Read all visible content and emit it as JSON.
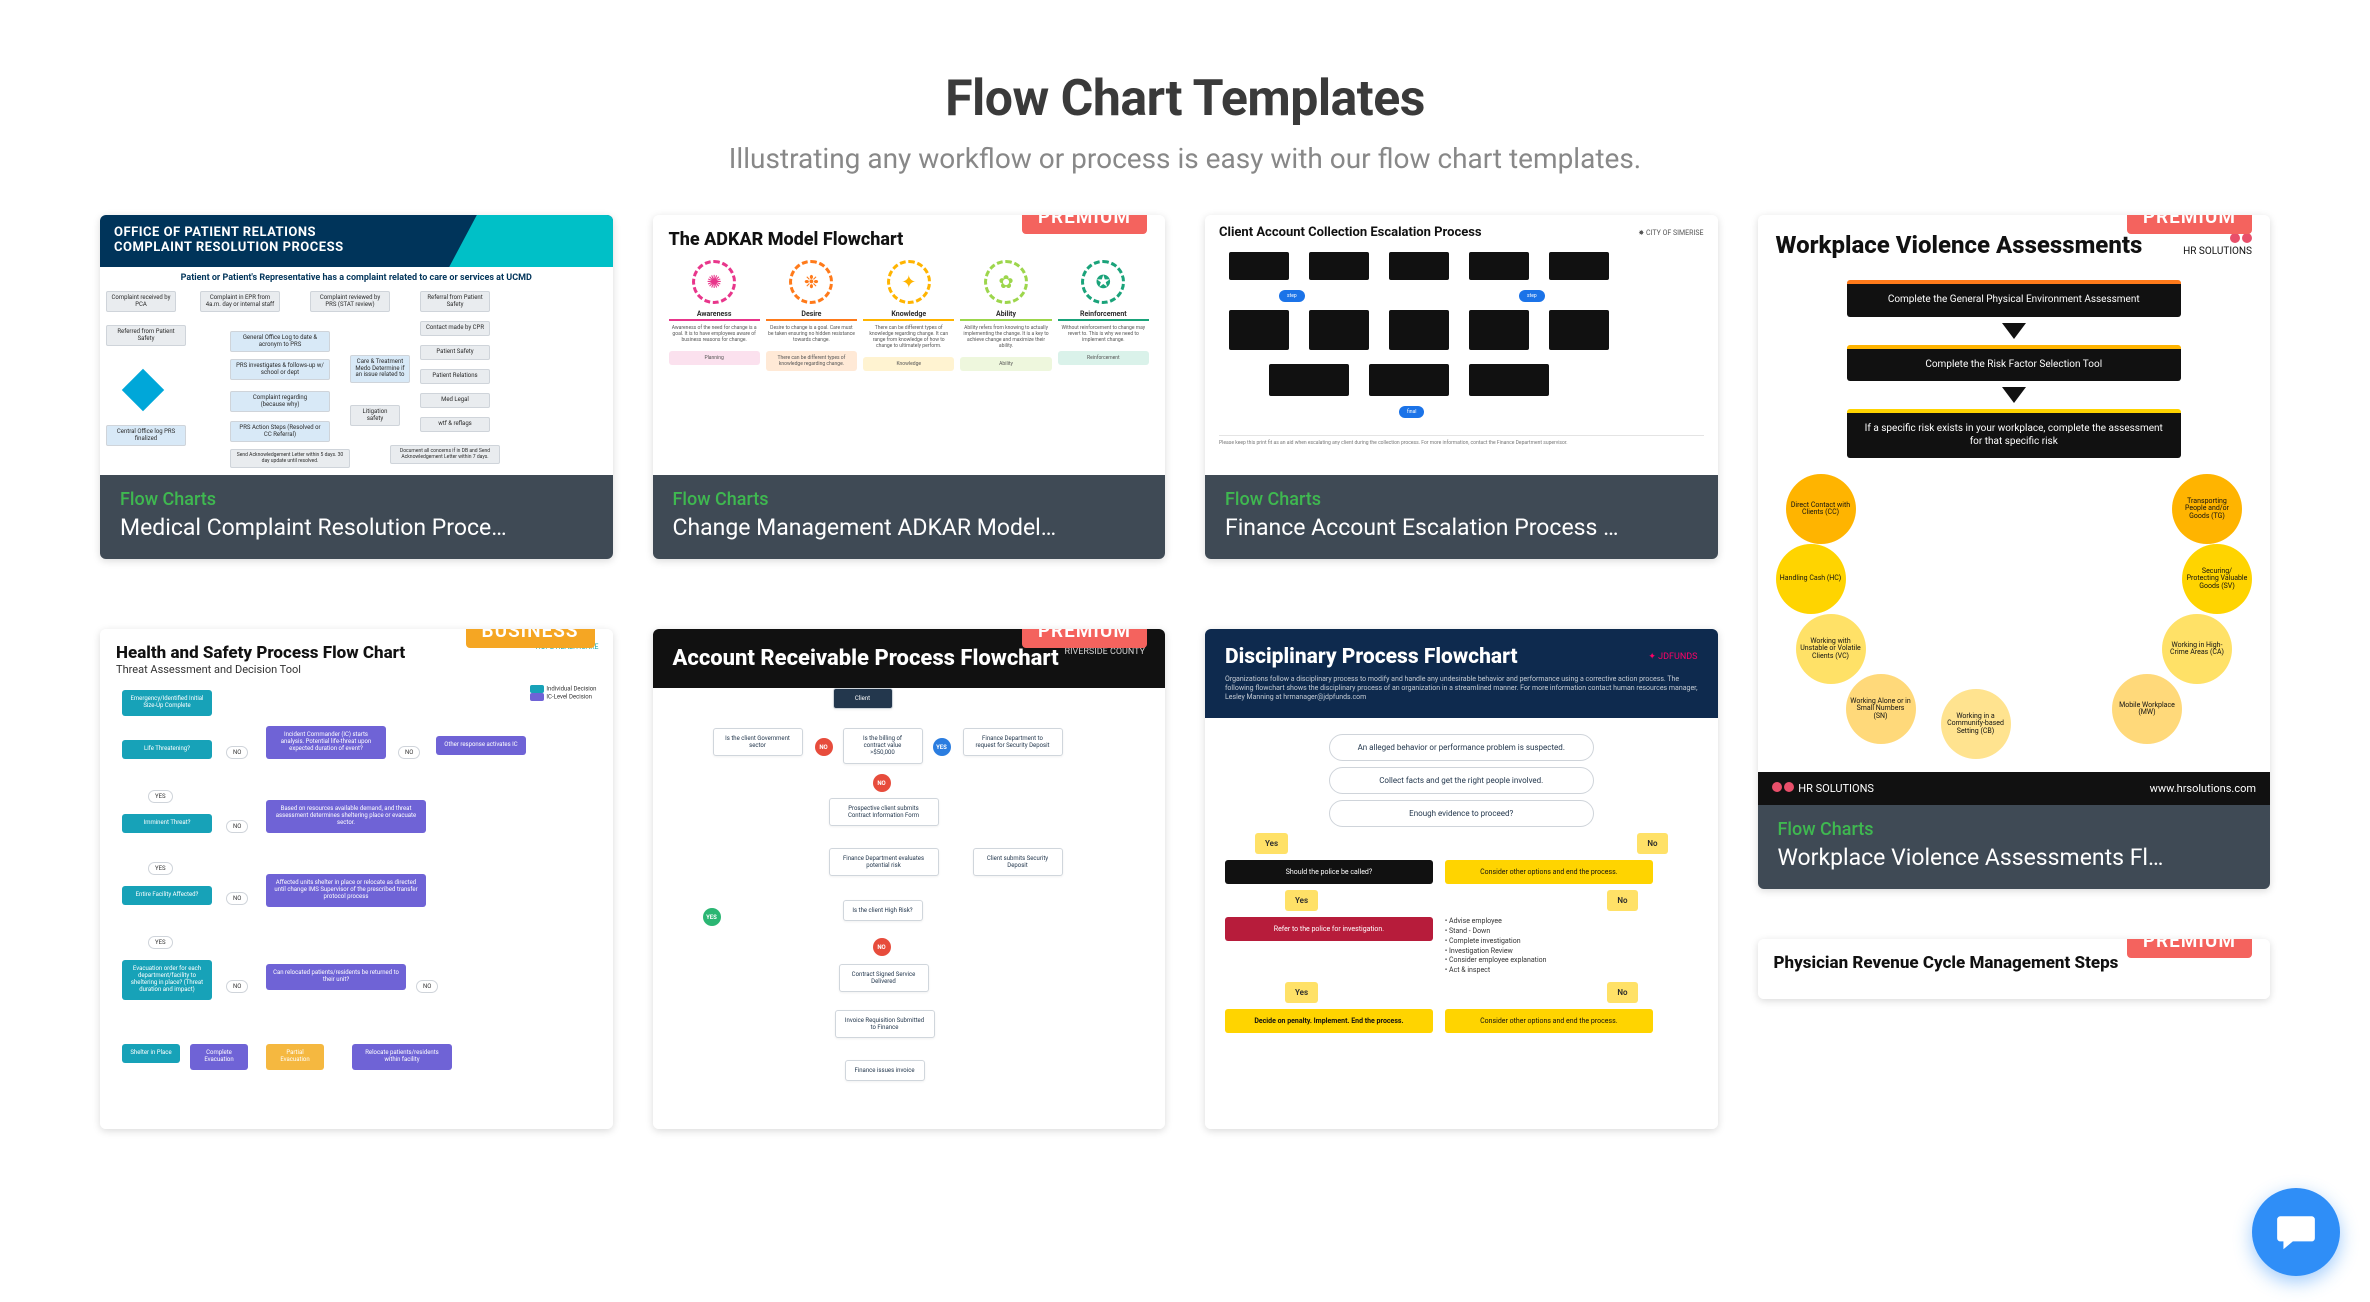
{
  "header": {
    "title": "Flow Chart Templates",
    "subtitle": "Illustrating any workflow or process is easy with our flow chart templates."
  },
  "badges": {
    "premium": "PREMIUM",
    "business": "BUSINESS"
  },
  "cards": {
    "c1": {
      "category": "Flow Charts",
      "title": "Medical Complaint Resolution Proce…",
      "thumb_header1": "OFFICE OF PATIENT RELATIONS",
      "thumb_header2": "COMPLAINT RESOLUTION PROCESS",
      "thumb_sub": "Patient or Patient's Representative has a complaint related to care or services at UCMD"
    },
    "c2": {
      "category": "Flow Charts",
      "title": "Change Management ADKAR Model…",
      "thumb_title": "The ADKAR Model Flowchart",
      "labels": [
        "Awareness",
        "Desire",
        "Knowledge",
        "Ability",
        "Reinforcement"
      ],
      "colors": [
        "#e8368b",
        "#ff7a1a",
        "#ffb400",
        "#9dd64c",
        "#1aa37a"
      ]
    },
    "c3": {
      "category": "Flow Charts",
      "title": "Finance Account Escalation Process …",
      "thumb_title": "Client Account Collection Escalation Process",
      "brand": "CITY OF SIMERISE"
    },
    "c4": {
      "category": "Flow Charts",
      "title": "Workplace Violence Assessments Fl…",
      "thumb_title": "Workplace Violence Assessments",
      "brand": "HR SOLUTIONS",
      "steps": [
        "Complete the General Physical Environment Assessment",
        "Complete the Risk Factor Selection Tool",
        "If a specific risk exists in your workplace, complete the assessment for that specific risk"
      ],
      "bubbles": [
        {
          "t": "Direct Contact with Clients (CC)",
          "c": "#ffb400"
        },
        {
          "t": "Handling Cash (HC)",
          "c": "#ffd400"
        },
        {
          "t": "Working with Unstable or Volatile Clients (VC)",
          "c": "#ffe167"
        },
        {
          "t": "Working Alone or in Small Numbers (SN)",
          "c": "#ffd97a"
        },
        {
          "t": "Working in a Community-based Setting (CB)",
          "c": "#ffe38f"
        },
        {
          "t": "Mobile Workplace (MW)",
          "c": "#ffd97a"
        },
        {
          "t": "Working in High-Crime Areas (CA)",
          "c": "#ffe167"
        },
        {
          "t": "Securing/ Protecting Valuable Goods (SV)",
          "c": "#ffd400"
        },
        {
          "t": "Transporting People and/or Goods (TG)",
          "c": "#ffb400"
        }
      ],
      "footer_brand": "HR SOLUTIONS",
      "footer_url": "www.hrsolutions.com"
    },
    "c5": {
      "thumb_title": "Health and Safety Process Flow Chart",
      "thumb_sub": "Threat Assessment and Decision Tool",
      "brand": "HOPE HEALTHCARE",
      "legend": [
        "Individual Decision",
        "IC-Level Decision"
      ]
    },
    "c6": {
      "thumb_title": "Account Receivable Process Flowchart",
      "brand": "RIVERSIDE COUNTY",
      "nodes": {
        "client": "Client",
        "n1": "Is the client Government sector",
        "n2": "Is the billing of contract value >$50,000",
        "n3": "Finance Department to request for Security Deposit",
        "n4": "Prospective client submits Contract Information Form",
        "n5": "Finance Department evaluates potential risk",
        "n6": "Client submits Security Deposit",
        "n7": "Is the client High Risk?",
        "n8": "Contract Signed Service Delivered",
        "n9": "Invoice Requisition Submitted to Finance",
        "n10": "Finance issues invoice"
      }
    },
    "c7": {
      "thumb_title": "Disciplinary Process Flowchart",
      "brand": "JDFUNDS",
      "intro": "Organizations follow a disciplinary process to modify and handle any undesirable behavior and performance using a corrective action process. The following flowchart shows the disciplinary process of an organization in a streamlined manner. For more information contact human resources manager, Lesley Manning at hrmanager@jdpfunds.com",
      "s1": "An alleged behavior or performance problem is suspected.",
      "s2": "Collect facts and get the right people involved.",
      "s3": "Enough evidence to proceed?",
      "yes": "Yes",
      "no": "No",
      "q": "Should the police be called?",
      "alt": "Consider other options and end the process.",
      "police": "Refer to the police for investigation.",
      "list": [
        "Advise employee",
        "Stand - Down",
        "Complete investigation",
        "Investigation Review",
        "Consider employee explanation",
        "Act & inspect"
      ],
      "d": "Decide on penalty.  Implement.  End the process.",
      "alt2": "Consider other options and end the process."
    },
    "c8": {
      "thumb_title": "Physician Revenue Cycle Management Steps"
    }
  },
  "chat": {
    "label": "chat-launcher"
  }
}
